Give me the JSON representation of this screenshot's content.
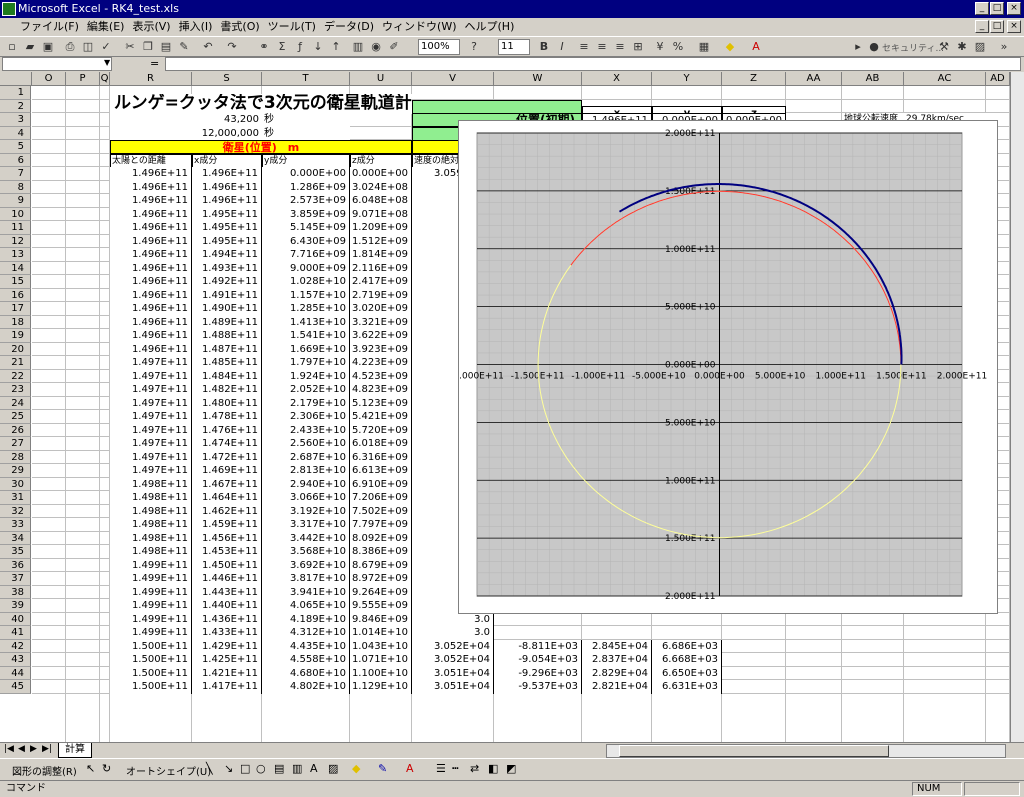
{
  "window": {
    "title": "Microsoft Excel - RK4_test.xls"
  },
  "menu": [
    "ファイル(F)",
    "編集(E)",
    "表示(V)",
    "挿入(I)",
    "書式(O)",
    "ツール(T)",
    "データ(D)",
    "ウィンドウ(W)",
    "ヘルプ(H)"
  ],
  "toolbar": {
    "zoom": "100%",
    "font_size": "11",
    "security_label": "セキュリティ..."
  },
  "formula": {
    "name_box": "",
    "equals": "="
  },
  "columns": [
    "O",
    "P",
    "Q",
    "R",
    "S",
    "T",
    "U",
    "V",
    "W",
    "X",
    "Y",
    "Z",
    "AA",
    "AB",
    "AC",
    "AD"
  ],
  "sheet": {
    "title": "ルンゲ=クッタ法で3次元の衛星軌道計算",
    "dt_label": "dt(step)=",
    "dt_value": "43,200",
    "dt_unit": "秒",
    "time_label": "計算時間=",
    "time_value": "12,000,000",
    "time_unit": "秒",
    "pos_header": "衛星(位置)　m",
    "vel_header": "衛星(速度)　m/sec",
    "col_headers": [
      "太陽との距離",
      "x成分",
      "y成分",
      "z成分",
      "速度の絶対値",
      "x成分",
      "y成分",
      "z成分"
    ],
    "init_x": "x",
    "init_y": "y",
    "init_z": "z",
    "init_pos_label": "位置(初期)",
    "init_pos": [
      "1.496E+11",
      "0.000E+00",
      "0.000E+00"
    ],
    "init_vel_label": "速度(初期)",
    "init_vel": [
      "0.000E+00",
      "2.978E+04",
      "7.000E+03"
    ],
    "earth_speed_label": "地球公転速度",
    "earth_speed_value": "29.78km/sec",
    "earth_radius_label": "地球公転半径",
    "earth_radius_value": "1.4960E+11 m",
    "btn_calc": "計算開始",
    "btn_reset": "リセット"
  },
  "rows": [
    [
      "1.496E+11",
      "1.496E+11",
      "0.000E+00",
      "0.000E+00",
      "3.059E+04",
      "0.000E+00",
      "2.978E+04",
      "7.000E+03"
    ],
    [
      "1.496E+11",
      "1.496E+11",
      "1.286E+09",
      "3.024E+08",
      "3.0",
      "",
      "",
      ""
    ],
    [
      "1.496E+11",
      "1.496E+11",
      "2.573E+09",
      "6.048E+08",
      "3.0",
      "",
      "",
      ""
    ],
    [
      "1.496E+11",
      "1.495E+11",
      "3.859E+09",
      "9.071E+08",
      "3.0",
      "",
      "",
      ""
    ],
    [
      "1.496E+11",
      "1.495E+11",
      "5.145E+09",
      "1.209E+09",
      "3.0",
      "",
      "",
      ""
    ],
    [
      "1.496E+11",
      "1.495E+11",
      "6.430E+09",
      "1.512E+09",
      "3.0",
      "",
      "",
      ""
    ],
    [
      "1.496E+11",
      "1.494E+11",
      "7.716E+09",
      "1.814E+09",
      "3.0",
      "",
      "",
      ""
    ],
    [
      "1.496E+11",
      "1.493E+11",
      "9.000E+09",
      "2.116E+09",
      "3.0",
      "",
      "",
      ""
    ],
    [
      "1.496E+11",
      "1.492E+11",
      "1.028E+10",
      "2.417E+09",
      "3.0",
      "",
      "",
      ""
    ],
    [
      "1.496E+11",
      "1.491E+11",
      "1.157E+10",
      "2.719E+09",
      "3.0",
      "",
      "",
      ""
    ],
    [
      "1.496E+11",
      "1.490E+11",
      "1.285E+10",
      "3.020E+09",
      "3.0",
      "",
      "",
      ""
    ],
    [
      "1.496E+11",
      "1.489E+11",
      "1.413E+10",
      "3.321E+09",
      "3.0",
      "",
      "",
      ""
    ],
    [
      "1.496E+11",
      "1.488E+11",
      "1.541E+10",
      "3.622E+09",
      "3.0",
      "",
      "",
      ""
    ],
    [
      "1.496E+11",
      "1.487E+11",
      "1.669E+10",
      "3.923E+09",
      "3.0",
      "",
      "",
      ""
    ],
    [
      "1.497E+11",
      "1.485E+11",
      "1.797E+10",
      "4.223E+09",
      "3.0",
      "",
      "",
      ""
    ],
    [
      "1.497E+11",
      "1.484E+11",
      "1.924E+10",
      "4.523E+09",
      "3.0",
      "",
      "",
      ""
    ],
    [
      "1.497E+11",
      "1.482E+11",
      "2.052E+10",
      "4.823E+09",
      "3.0",
      "",
      "",
      ""
    ],
    [
      "1.497E+11",
      "1.480E+11",
      "2.179E+10",
      "5.123E+09",
      "3.0",
      "",
      "",
      ""
    ],
    [
      "1.497E+11",
      "1.478E+11",
      "2.306E+10",
      "5.421E+09",
      "3.0",
      "",
      "",
      ""
    ],
    [
      "1.497E+11",
      "1.476E+11",
      "2.433E+10",
      "5.720E+09",
      "3.0",
      "",
      "",
      ""
    ],
    [
      "1.497E+11",
      "1.474E+11",
      "2.560E+10",
      "6.018E+09",
      "3.0",
      "",
      "",
      ""
    ],
    [
      "1.497E+11",
      "1.472E+11",
      "2.687E+10",
      "6.316E+09",
      "3.0",
      "",
      "",
      ""
    ],
    [
      "1.497E+11",
      "1.469E+11",
      "2.813E+10",
      "6.613E+09",
      "3.0",
      "",
      "",
      ""
    ],
    [
      "1.498E+11",
      "1.467E+11",
      "2.940E+10",
      "6.910E+09",
      "3.0",
      "",
      "",
      ""
    ],
    [
      "1.498E+11",
      "1.464E+11",
      "3.066E+10",
      "7.206E+09",
      "3.0",
      "",
      "",
      ""
    ],
    [
      "1.498E+11",
      "1.462E+11",
      "3.192E+10",
      "7.502E+09",
      "3.0",
      "",
      "",
      ""
    ],
    [
      "1.498E+11",
      "1.459E+11",
      "3.317E+10",
      "7.797E+09",
      "3.0",
      "",
      "",
      ""
    ],
    [
      "1.498E+11",
      "1.456E+11",
      "3.442E+10",
      "8.092E+09",
      "3.0",
      "",
      "",
      ""
    ],
    [
      "1.498E+11",
      "1.453E+11",
      "3.568E+10",
      "8.386E+09",
      "3.0",
      "",
      "",
      ""
    ],
    [
      "1.499E+11",
      "1.450E+11",
      "3.692E+10",
      "8.679E+09",
      "3.0",
      "",
      "",
      ""
    ],
    [
      "1.499E+11",
      "1.446E+11",
      "3.817E+10",
      "8.972E+09",
      "3.0",
      "",
      "",
      ""
    ],
    [
      "1.499E+11",
      "1.443E+11",
      "3.941E+10",
      "9.264E+09",
      "3.0",
      "",
      "",
      ""
    ],
    [
      "1.499E+11",
      "1.440E+11",
      "4.065E+10",
      "9.555E+09",
      "3.0",
      "",
      "",
      ""
    ],
    [
      "1.499E+11",
      "1.436E+11",
      "4.189E+10",
      "9.846E+09",
      "3.0",
      "",
      "",
      ""
    ],
    [
      "1.499E+11",
      "1.433E+11",
      "4.312E+10",
      "1.014E+10",
      "3.0",
      "",
      "",
      ""
    ],
    [
      "1.500E+11",
      "1.429E+11",
      "4.435E+10",
      "1.043E+10",
      "3.052E+04",
      "-8.811E+03",
      "2.845E+04",
      "6.686E+03"
    ],
    [
      "1.500E+11",
      "1.425E+11",
      "4.558E+10",
      "1.071E+10",
      "3.052E+04",
      "-9.054E+03",
      "2.837E+04",
      "6.668E+03"
    ],
    [
      "1.500E+11",
      "1.421E+11",
      "4.680E+10",
      "1.100E+10",
      "3.051E+04",
      "-9.296E+03",
      "2.829E+04",
      "6.650E+03"
    ],
    [
      "1.500E+11",
      "1.417E+11",
      "4.802E+10",
      "1.129E+10",
      "3.051E+04",
      "-9.537E+03",
      "2.821E+04",
      "6.631E+03"
    ]
  ],
  "chart_data": {
    "type": "scatter",
    "x_ticks": [
      "-2.000E+11",
      "-1.500E+11",
      "-1.000E+11",
      "-5.000E+10",
      "0.000E+00",
      "5.000E+10",
      "1.000E+11",
      "1.500E+11",
      "2.000E+11"
    ],
    "y_ticks": [
      "2.000E+11",
      "1.500E+11",
      "1.000E+11",
      "5.000E+10",
      "0.000E+00",
      "5.000E+10",
      "1.000E+11",
      "1.500E+11",
      "2.000E+11"
    ],
    "xlim": [
      -200000000000.0,
      200000000000.0
    ],
    "ylim": [
      -200000000000.0,
      200000000000.0
    ],
    "grid": true,
    "series": [
      {
        "color": "#ffff99",
        "shape": "circle",
        "radius": 149600000000.0,
        "start_deg": 0,
        "end_deg": 360
      },
      {
        "color": "#ff3333",
        "shape": "circle",
        "radius": 149600000000.0,
        "start_deg": 0,
        "end_deg": 145
      },
      {
        "color": "#000080",
        "shape": "orbit",
        "radius": 150000000000.0,
        "start_deg": 0,
        "end_deg": 122
      }
    ]
  },
  "sheet_tab": "計算",
  "drawbar": {
    "draw_label": "図形の調整(R)",
    "autoshape_label": "オートシェイプ(U)"
  },
  "status": {
    "left": "コマンド",
    "num": "NUM"
  }
}
